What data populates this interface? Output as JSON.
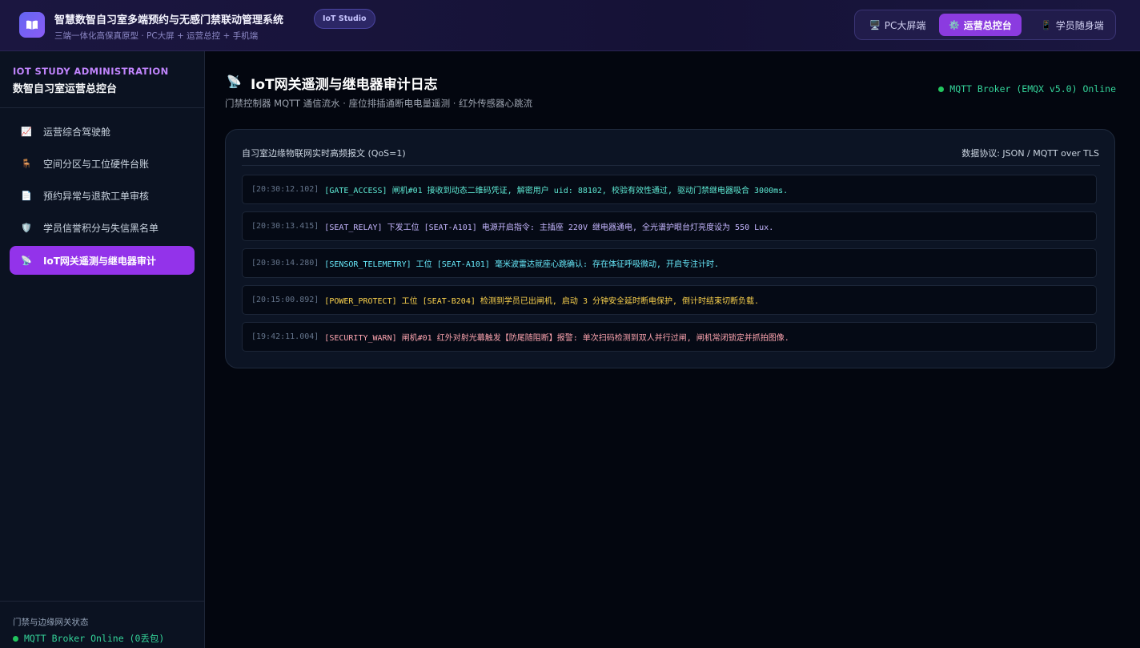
{
  "header": {
    "title": "智慧数智自习室多端预约与无感门禁联动管理系统",
    "subtitle": "三端一体化高保真原型 · PC大屏 + 运营总控 + 手机端",
    "badge": "IoT Studio",
    "logo_icon": "book-icon",
    "tabs": [
      {
        "label": "PC大屏端",
        "icon": "monitor-icon",
        "glyph": "🖥️",
        "active": false
      },
      {
        "label": "运营总控台",
        "icon": "gear-icon",
        "glyph": "⚙️",
        "active": true
      },
      {
        "label": "学员随身端",
        "icon": "phone-icon",
        "glyph": "📱",
        "active": false
      }
    ]
  },
  "sidebar": {
    "eyebrow": "IOT STUDY ADMINISTRATION",
    "title": "数智自习室运营总控台",
    "items": [
      {
        "label": "运营综合驾驶舱",
        "icon": "chart-icon",
        "glyph": "📈",
        "active": false
      },
      {
        "label": "空间分区与工位硬件台账",
        "icon": "desk-icon",
        "glyph": "🪑",
        "active": false
      },
      {
        "label": "预约异常与退款工单审核",
        "icon": "document-icon",
        "glyph": "📄",
        "active": false
      },
      {
        "label": "学员信誉积分与失信黑名单",
        "icon": "shield-icon",
        "glyph": "🛡️",
        "active": false
      },
      {
        "label": "IoT网关遥测与继电器审计",
        "icon": "satellite-icon",
        "glyph": "📡",
        "active": true
      }
    ],
    "footer_label": "门禁与边缘网关状态",
    "footer_status": "MQTT Broker Online (0丢包)"
  },
  "main": {
    "title": "IoT网关遥测与继电器审计日志",
    "title_icon": "satellite-icon",
    "title_glyph": "📡",
    "subtitle": "门禁控制器 MQTT 通信流水 · 座位排插通断电电量遥测 · 红外传感器心跳流",
    "broker_status": "MQTT Broker (EMQX v5.0) Online",
    "panel": {
      "title": "自习室边缘物联网实时高频报文 (QoS=1)",
      "protocol": "数据协议: JSON / MQTT over TLS",
      "logs": [
        {
          "timestamp": "[20:30:12.102]",
          "message": "[GATE_ACCESS] 闸机#01 接收到动态二维码凭证, 解密用户 uid: 88102, 校验有效性通过, 驱动门禁继电器吸合 3000ms.",
          "color": "#5eead4"
        },
        {
          "timestamp": "[20:30:13.415]",
          "message": "[SEAT_RELAY] 下发工位 [SEAT-A101] 电源开启指令: 主插座 220V 继电器通电, 全光谱护眼台灯亮度设为 550 Lux.",
          "color": "#c4b5fd"
        },
        {
          "timestamp": "[20:30:14.280]",
          "message": "[SENSOR_TELEMETRY] 工位 [SEAT-A101] 毫米波雷达就座心跳确认: 存在体征呼吸微动, 开启专注计时.",
          "color": "#67e8f9"
        },
        {
          "timestamp": "[20:15:00.892]",
          "message": "[POWER_PROTECT] 工位 [SEAT-B204] 检测到学员已出闸机, 启动 3 分钟安全延时断电保护, 倒计时结束切断负载.",
          "color": "#fcd34d"
        },
        {
          "timestamp": "[19:42:11.004]",
          "message": "[SECURITY_WARN] 闸机#01 红外对射光幕触发【防尾随阻断】报警: 单次扫码检测到双人并行过闸, 闸机常闭锁定并抓拍图像.",
          "color": "#fda4af"
        }
      ]
    }
  },
  "colors": {
    "accent": "#9333ea",
    "online": "#22c55e",
    "background": "#03060f"
  }
}
